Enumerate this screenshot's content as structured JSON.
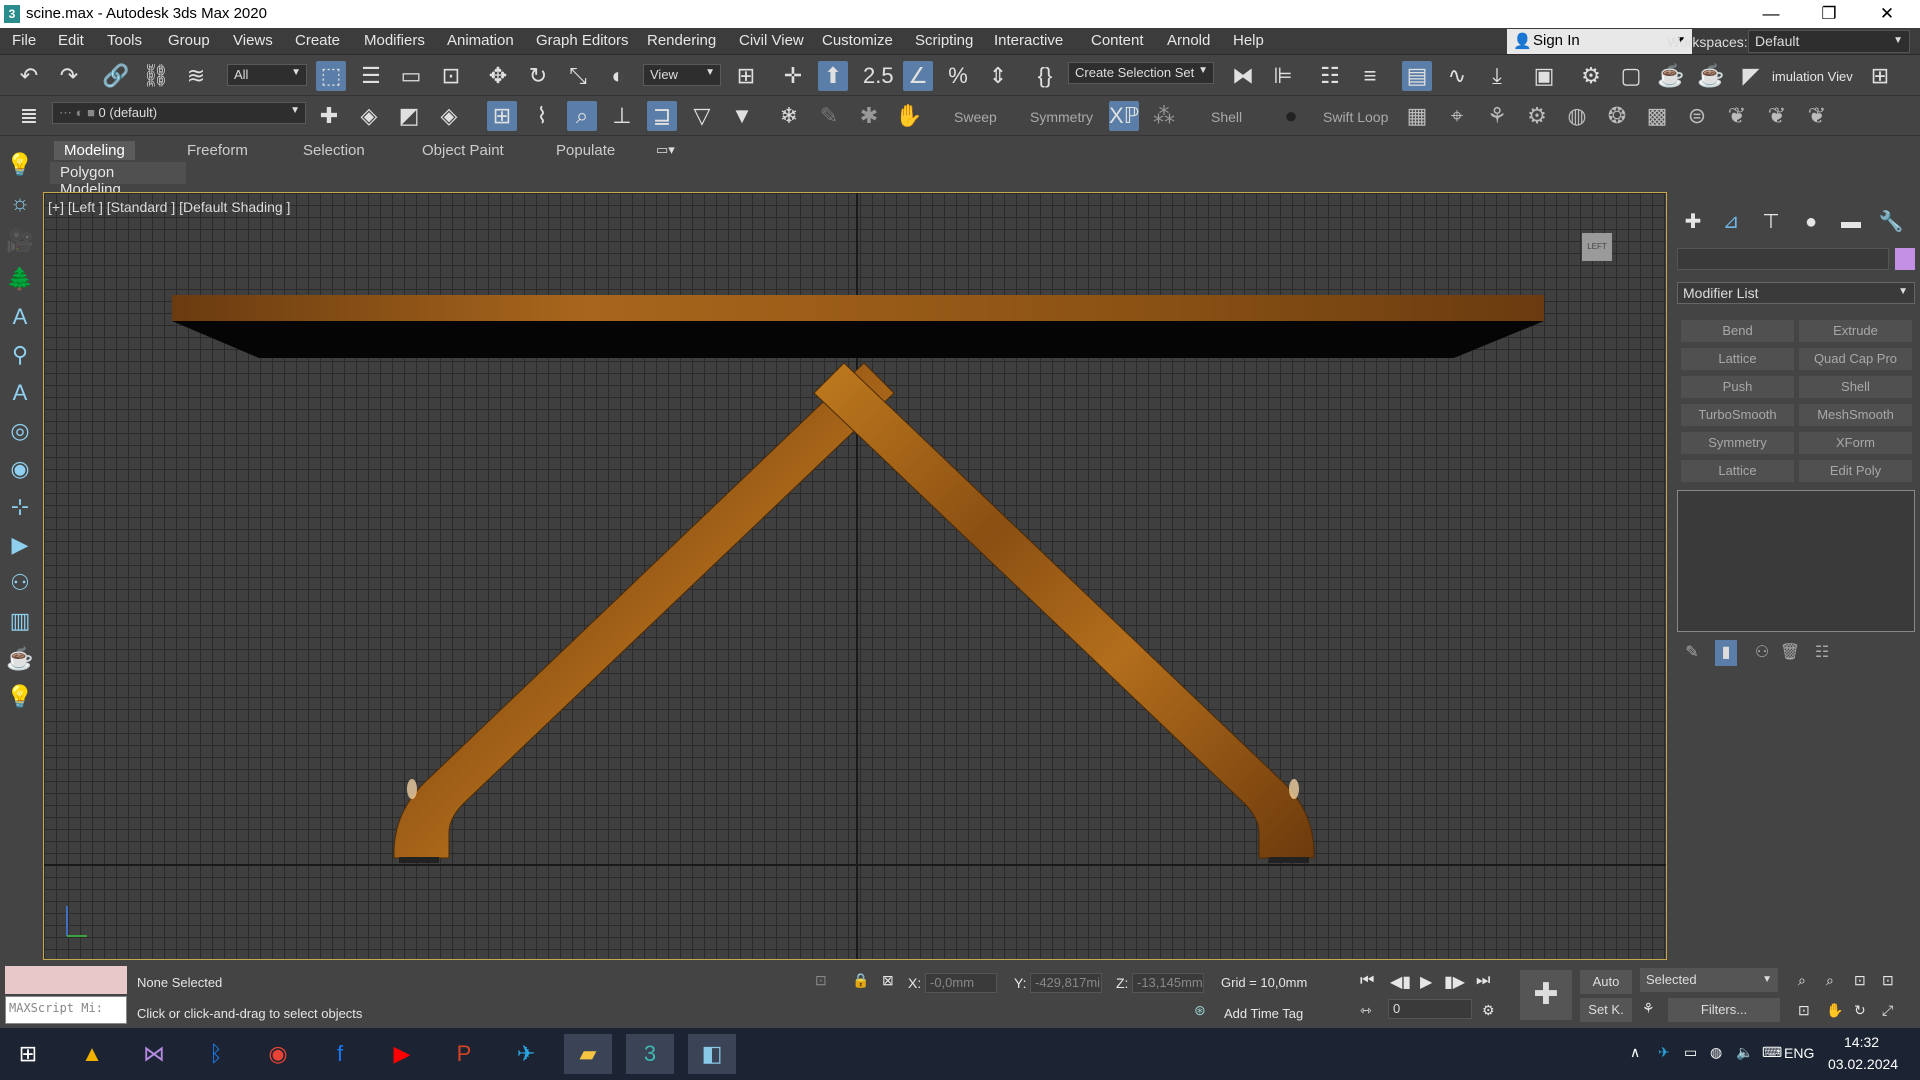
{
  "window": {
    "title": "scine.max - Autodesk 3ds Max 2020",
    "app_icon": "3"
  },
  "window_controls": {
    "minimize": "—",
    "restore": "❐",
    "close": "✕"
  },
  "menu": [
    "File",
    "Edit",
    "Tools",
    "Group",
    "Views",
    "Create",
    "Modifiers",
    "Animation",
    "Graph Editors",
    "Rendering",
    "Civil View",
    "Customize",
    "Scripting",
    "Interactive",
    "Content",
    "Arnold",
    "Help"
  ],
  "signin": {
    "label": "Sign In"
  },
  "workspaces": {
    "label": "Workspaces:",
    "value": "Default"
  },
  "toolbar": {
    "filter_value": "All",
    "refcoord_value": "View",
    "selection_set_value": "Create Selection Set",
    "simulation_label": "imulation Viev",
    "layer_value": "0 (default)",
    "sweep_label": "Sweep",
    "symmetry_label": "Symmetry",
    "shell_label": "Shell",
    "swiftloop_label": "Swift Loop"
  },
  "ribbon": {
    "tabs": [
      "Modeling",
      "Freeform",
      "Selection",
      "Object Paint",
      "Populate"
    ],
    "active_tab": "Modeling",
    "panel_label": "Polygon Modeling"
  },
  "viewport": {
    "label": "[+] [Left ] [Standard ] [Default Shading ]",
    "viewcube_label": "LEFT"
  },
  "command_panel": {
    "modifier_list": "Modifier List",
    "object_color": "#c490e6",
    "buttons": [
      "Bend",
      "Extrude",
      "Lattice",
      "Quad Cap Pro",
      "Push",
      "Shell",
      "TurboSmooth",
      "MeshSmooth",
      "Symmetry",
      "XForm",
      "Lattice",
      "Edit Poly"
    ]
  },
  "status": {
    "selection": "None Selected",
    "prompt": "Click or click-and-drag to select objects",
    "maxscript": "MAXScript Mi:",
    "x_label": "X:",
    "x_value": "-0,0mm",
    "y_label": "Y:",
    "y_value": "-429,817mi",
    "z_label": "Z:",
    "z_value": "-13,145mm",
    "grid": "Grid = 10,0mm",
    "add_time_tag": "Add Time Tag",
    "auto": "Auto",
    "selected": "Selected",
    "setk": "Set K.",
    "filters": "Filters...",
    "frame": "0"
  },
  "taskbar": {
    "lang": "ENG",
    "time": "14:32",
    "date": "03.02.2024"
  }
}
